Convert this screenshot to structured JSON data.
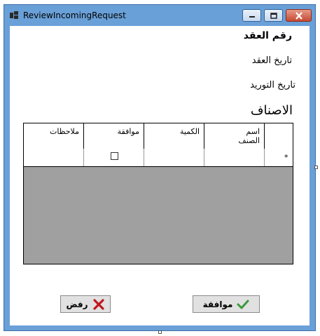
{
  "window": {
    "title": "ReviewIncomingRequest",
    "controls": {
      "minimize": "minimize",
      "maximize": "maximize",
      "close": "close"
    }
  },
  "form": {
    "contract_number_label": "رقم العقد",
    "contract_date_label": "تاريخ العقد",
    "supply_date_label": "تاريخ التوريد",
    "items_label": "الاصناف"
  },
  "grid": {
    "columns": [
      "ملاحظات",
      "موافقة",
      "الكمية",
      "اسم الصنف"
    ],
    "new_row_marker": "*"
  },
  "buttons": {
    "reject_label": "رفض",
    "approve_label": "موافقة"
  },
  "colors": {
    "titlebar": "#6aa0d8",
    "grid_background": "#a0a0a0",
    "button_face": "#e1e1e1",
    "reject_icon": "#c0171f",
    "approve_icon": "#3a9a3a"
  }
}
